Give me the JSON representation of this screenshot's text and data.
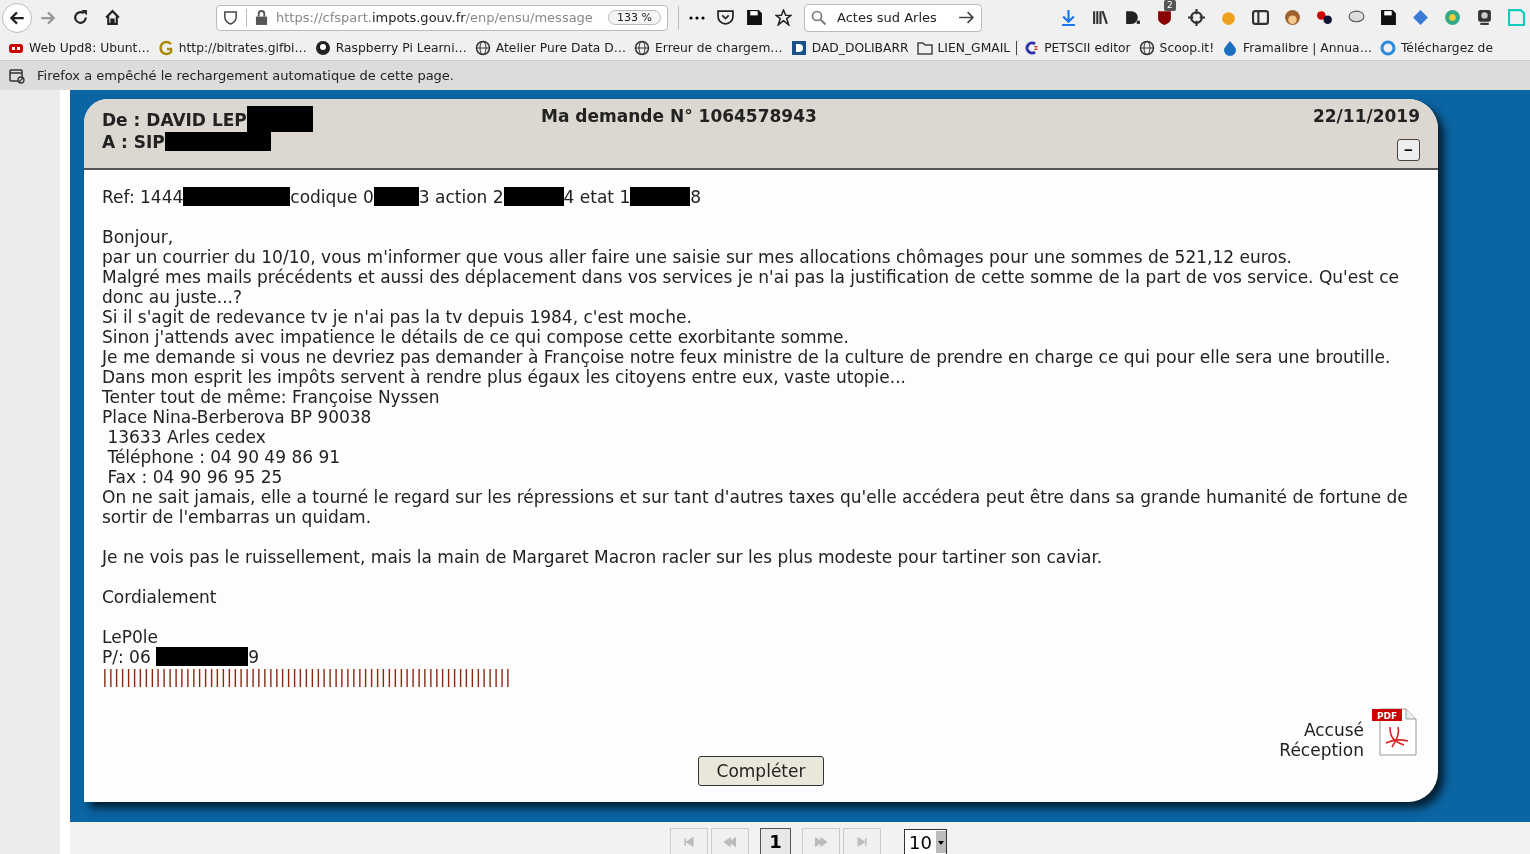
{
  "browser": {
    "url_prefix": "https://cfspart.",
    "url_domain": "impots.gouv.fr",
    "url_path": "/enp/ensu/message",
    "zoom": "133 %",
    "search": "Actes sud Arles",
    "badge": "2"
  },
  "bookmarks": [
    {
      "label": "Web Upd8: Ubunt…"
    },
    {
      "label": "http://bitrates.gifbi…"
    },
    {
      "label": "Raspberry Pi Learni…"
    },
    {
      "label": "Atelier Pure Data D…"
    },
    {
      "label": "Erreur de chargem…"
    },
    {
      "label": "DAD_DOLIBARR"
    },
    {
      "label": "LIEN_GMAIL"
    },
    {
      "label": "PETSCII editor"
    },
    {
      "label": "Scoop.it!"
    },
    {
      "label": "Framalibre | Annua…"
    },
    {
      "label": "Téléchargez de"
    }
  ],
  "notification": "Firefox a empêché le rechargement automatique de cette page.",
  "message": {
    "from": [
      {
        "kind": "text",
        "text": "De : DAVID LEP"
      },
      {
        "kind": "redacted"
      }
    ],
    "to": [
      {
        "kind": "text",
        "text": "A : SIP"
      },
      {
        "kind": "redacted"
      }
    ],
    "title": "Ma demande N° 1064578943",
    "date": "22/11/2019",
    "collapse": "−",
    "body": [
      [
        [
          {
            "kind": "text",
            "text": "Ref: 1444"
          },
          {
            "kind": "redacted"
          },
          {
            "kind": "text",
            "text": "codique 0"
          },
          {
            "kind": "redacted"
          },
          {
            "kind": "text",
            "text": "3 action 2"
          },
          {
            "kind": "redacted"
          },
          {
            "kind": "text",
            "text": "4 etat 1"
          },
          {
            "kind": "redacted"
          },
          {
            "kind": "text",
            "text": "8"
          }
        ]
      ],
      [
        [
          {
            "kind": "text",
            "text": "Bonjour,"
          }
        ],
        [
          {
            "kind": "text",
            "text": "par un courrier du 10/10, vous m'informer que vous aller faire une saisie sur mes allocations chômages pour une sommes de 521,12 euros."
          }
        ],
        [
          {
            "kind": "text",
            "text": "Malgré mes mails précédents et aussi des déplacement dans vos services je n'ai pas la justification de cette somme de la part de vos service. Qu'est ce donc au juste...?"
          }
        ],
        [
          {
            "kind": "text",
            "text": "Si il s'agit de redevance tv je n'ai pas la tv depuis 1984, c'est moche."
          }
        ],
        [
          {
            "kind": "text",
            "text": "Sinon j'attends avec impatience le détails de ce qui compose cette exorbitante somme."
          }
        ],
        [
          {
            "kind": "text",
            "text": "Je me demande si vous ne devriez pas demander à Françoise notre feux ministre de la culture de prendre en charge ce qui pour elle sera une broutille."
          }
        ],
        [
          {
            "kind": "text",
            "text": "Dans mon esprit les impôts servent à rendre plus égaux les citoyens entre eux, vaste utopie..."
          }
        ],
        [
          {
            "kind": "text",
            "text": "Tenter tout de même: Françoise Nyssen"
          }
        ],
        [
          {
            "kind": "text",
            "text": "Place Nina-Berberova BP 90038"
          }
        ],
        [
          {
            "kind": "text",
            "text": " 13633 Arles cedex"
          }
        ],
        [
          {
            "kind": "text",
            "text": " Téléphone : 04 90 49 86 91"
          }
        ],
        [
          {
            "kind": "text",
            "text": " Fax : 04 90 96 95 25"
          }
        ],
        [
          {
            "kind": "text",
            "text": "On ne sait jamais, elle a tourné le regard sur les répressions et sur tant d'autres taxes qu'elle accédera peut être dans sa grande humanité de fortune de sortir de l'embarras un quidam."
          }
        ]
      ],
      [
        [
          {
            "kind": "text",
            "text": "Je ne vois pas le ruissellement, mais la main de Margaret Macron racler sur les plus modeste pour tartiner son caviar."
          }
        ]
      ],
      [
        [
          {
            "kind": "text",
            "text": "Cordialement"
          }
        ]
      ],
      [
        [
          {
            "kind": "text",
            "text": "LeP0le"
          }
        ],
        [
          {
            "kind": "text",
            "text": "P/: 06 "
          },
          {
            "kind": "redacted"
          },
          {
            "kind": "text",
            "text": "9"
          }
        ],
        [
          {
            "kind": "rule",
            "text": "|||||||||||||||||||||||||||||||||||||||||||||||||||||||||||||||||||||"
          }
        ]
      ]
    ],
    "receipt": [
      "Accusé",
      "Réception"
    ],
    "receipt_icon_label": "PDF",
    "button": "Compléter"
  },
  "pager": {
    "buttons": [
      {
        "kind": "first",
        "disabled": true
      },
      {
        "kind": "prev",
        "disabled": true
      },
      {
        "kind": "page",
        "label": "1",
        "selected": true
      },
      {
        "kind": "next",
        "disabled": true
      },
      {
        "kind": "last",
        "disabled": true
      }
    ],
    "page_size": "10"
  }
}
